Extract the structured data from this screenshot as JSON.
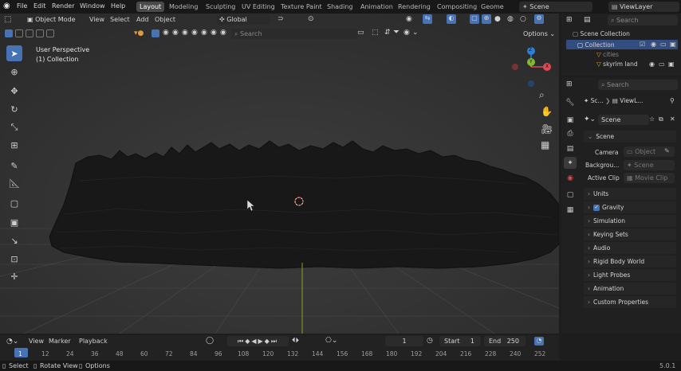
{
  "topbar": {
    "menus": [
      "File",
      "Edit",
      "Render",
      "Window",
      "Help"
    ],
    "workspaces": [
      "Layout",
      "Modeling",
      "Sculpting",
      "UV Editing",
      "Texture Paint",
      "Shading",
      "Animation",
      "Rendering",
      "Compositing",
      "Geome"
    ],
    "active_workspace": "Layout",
    "scene": "Scene",
    "view_layer": "ViewLayer"
  },
  "viewport_header": {
    "mode": "Object Mode",
    "menus": [
      "View",
      "Select",
      "Add",
      "Object"
    ],
    "orientation": "Global",
    "search_placeholder": "Search",
    "options": "Options"
  },
  "viewport": {
    "perspective": "User Perspective",
    "collection": "(1) Collection",
    "gizmo_axes": [
      "X",
      "Y",
      "Z"
    ]
  },
  "outliner": {
    "search_placeholder": "Search",
    "items": [
      {
        "label": "Scene Collection",
        "icon": "collection-icon"
      },
      {
        "label": "Collection",
        "icon": "collection-icon"
      },
      {
        "label": "cities",
        "icon": "mesh-icon"
      },
      {
        "label": "skyrim land",
        "icon": "mesh-icon"
      }
    ]
  },
  "properties": {
    "search_placeholder": "Search",
    "breadcrumb": [
      "Sc...",
      "ViewL..."
    ],
    "scene_name": "Scene",
    "scene_panel": "Scene",
    "camera_label": "Camera",
    "camera_value": "Object",
    "background_label": "Backgrou...",
    "background_value": "Scene",
    "clip_label": "Active Clip",
    "clip_value": "Movie Clip",
    "panels": [
      "Units",
      "Gravity",
      "Simulation",
      "Keying Sets",
      "Audio",
      "Rigid Body World",
      "Light Probes",
      "Animation",
      "Custom Properties"
    ]
  },
  "timeline": {
    "menus": [
      "View",
      "Marker",
      "Playback"
    ],
    "current_frame": "1",
    "start_label": "Start",
    "start": "1",
    "end_label": "End",
    "end": "250",
    "ruler": [
      "1",
      "12",
      "24",
      "36",
      "48",
      "60",
      "72",
      "84",
      "96",
      "108",
      "120",
      "132",
      "144",
      "156",
      "168",
      "180",
      "192",
      "204",
      "216",
      "228",
      "240",
      "252"
    ]
  },
  "statusbar": {
    "hints": [
      "Select",
      "Rotate View",
      "Options"
    ],
    "version": "5.0.1"
  },
  "colors": {
    "accent": "#4772b3",
    "gizmo_x": "#e04a55",
    "gizmo_y": "#84b831",
    "gizmo_z": "#2f7fd8"
  }
}
